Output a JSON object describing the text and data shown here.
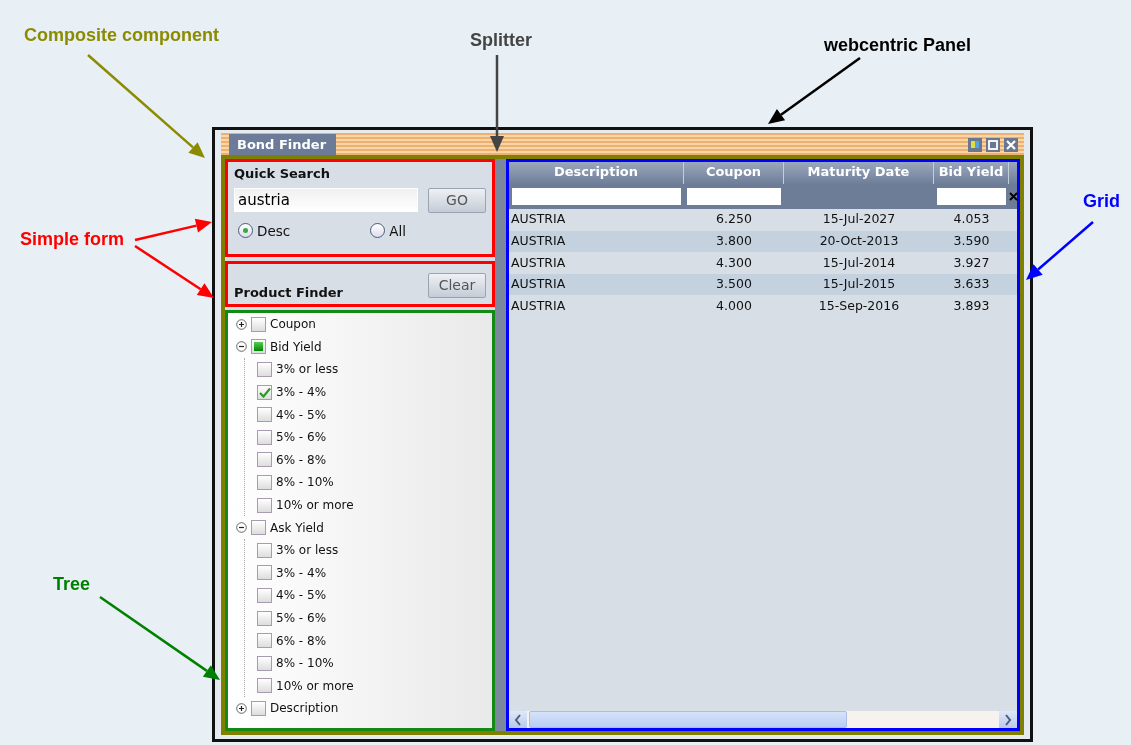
{
  "annotations": [
    {
      "text": "Composite component",
      "color": "#8b8b00"
    },
    {
      "text": "Splitter",
      "color": "#444444"
    },
    {
      "text": "webcentric Panel",
      "color": "#000000"
    },
    {
      "text": "Simple form",
      "color": "#ff0000"
    },
    {
      "text": "Grid",
      "color": "#0000ff"
    },
    {
      "text": "Tree",
      "color": "#008000"
    }
  ],
  "window": {
    "title": "Bond Finder"
  },
  "quick_search": {
    "title": "Quick Search",
    "value": "austria",
    "button": "GO",
    "options": [
      {
        "label": "Desc",
        "selected": true
      },
      {
        "label": "All",
        "selected": false
      }
    ]
  },
  "product_finder": {
    "title": "Product Finder",
    "button": "Clear"
  },
  "tree": [
    {
      "label": "Coupon",
      "expanded": false,
      "checked": false,
      "partial": false
    },
    {
      "label": "Bid Yield",
      "expanded": true,
      "checked": false,
      "partial": true,
      "children": [
        {
          "label": "3% or less",
          "checked": false
        },
        {
          "label": "3% - 4%",
          "checked": true
        },
        {
          "label": "4% - 5%",
          "checked": false
        },
        {
          "label": "5% - 6%",
          "checked": false
        },
        {
          "label": "6% - 8%",
          "checked": false
        },
        {
          "label": "8% - 10%",
          "checked": false
        },
        {
          "label": "10% or more",
          "checked": false
        }
      ]
    },
    {
      "label": "Ask Yield",
      "expanded": true,
      "checked": false,
      "partial": false,
      "children": [
        {
          "label": "3% or less",
          "checked": false
        },
        {
          "label": "3% - 4%",
          "checked": false
        },
        {
          "label": "4% - 5%",
          "checked": false
        },
        {
          "label": "5% - 6%",
          "checked": false
        },
        {
          "label": "6% - 8%",
          "checked": false
        },
        {
          "label": "8% - 10%",
          "checked": false
        },
        {
          "label": "10% or more",
          "checked": false
        }
      ]
    },
    {
      "label": "Description",
      "expanded": false,
      "checked": false,
      "partial": false
    }
  ],
  "grid": {
    "columns": [
      {
        "label": "Description",
        "filter": true
      },
      {
        "label": "Coupon",
        "filter": true
      },
      {
        "label": "Maturity Date",
        "filter": false
      },
      {
        "label": "Bid Yield",
        "filter": true
      }
    ],
    "rows": [
      [
        "AUSTRIA",
        "6.250",
        "15-Jul-2027",
        "4.053"
      ],
      [
        "AUSTRIA",
        "3.800",
        "20-Oct-2013",
        "3.590"
      ],
      [
        "AUSTRIA",
        "4.300",
        "15-Jul-2014",
        "3.927"
      ],
      [
        "AUSTRIA",
        "3.500",
        "15-Jul-2015",
        "3.633"
      ],
      [
        "AUSTRIA",
        "4.000",
        "15-Sep-2016",
        "3.893"
      ]
    ]
  }
}
